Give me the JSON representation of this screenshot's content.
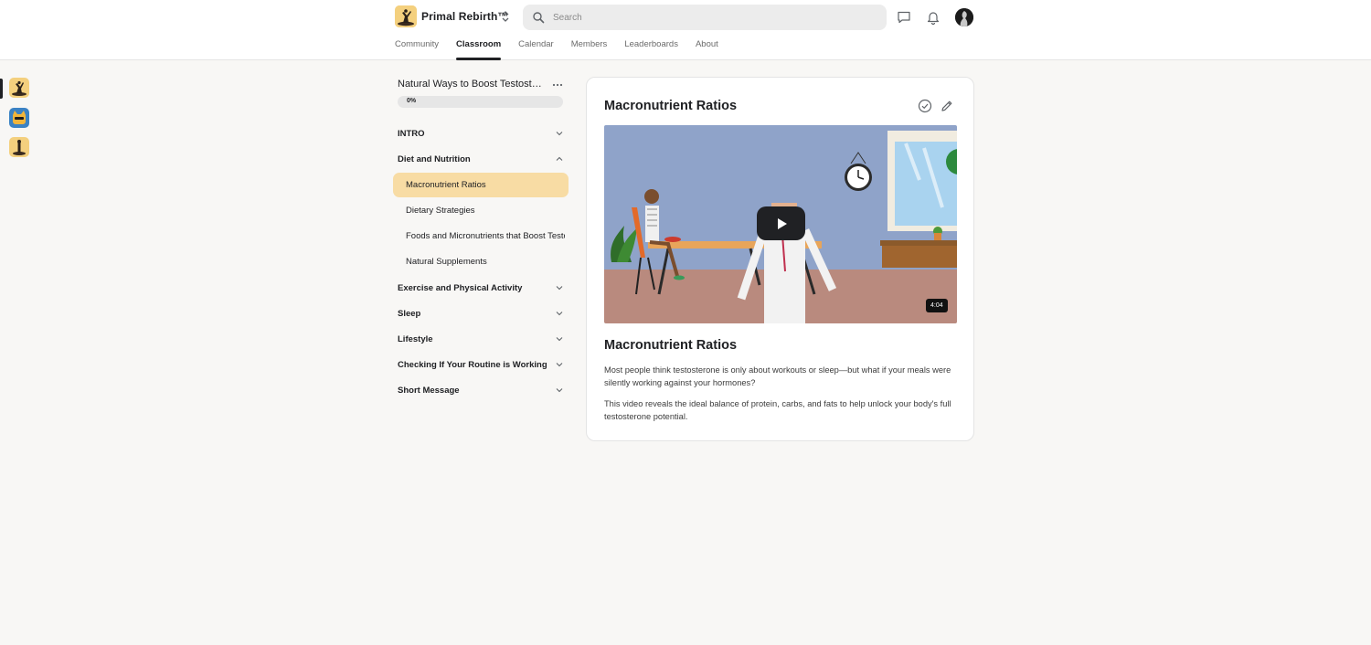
{
  "header": {
    "brand_name": "Primal Rebirth™",
    "search_placeholder": "Search",
    "nav": [
      {
        "label": "Community",
        "active": false
      },
      {
        "label": "Classroom",
        "active": true
      },
      {
        "label": "Calendar",
        "active": false
      },
      {
        "label": "Members",
        "active": false
      },
      {
        "label": "Leaderboards",
        "active": false
      },
      {
        "label": "About",
        "active": false
      }
    ],
    "icons": [
      "chat-icon",
      "bell-icon",
      "avatar"
    ]
  },
  "rail": {
    "apps": [
      {
        "name": "primal-rebirth-app",
        "color": "#f4d07e"
      },
      {
        "name": "cat-app",
        "color": "#3b82c4"
      },
      {
        "name": "statue-app",
        "color": "#f4d07e"
      }
    ]
  },
  "course": {
    "title": "Natural Ways to Boost Testosterone",
    "progress_label": "0%",
    "progress_value": 0,
    "sections": [
      {
        "label": "INTRO",
        "expanded": false
      },
      {
        "label": "Diet and Nutrition",
        "expanded": true
      },
      {
        "label": "Exercise and Physical Activity",
        "expanded": false
      },
      {
        "label": "Sleep",
        "expanded": false
      },
      {
        "label": "Lifestyle",
        "expanded": false
      },
      {
        "label": "Checking If Your Routine is Working",
        "expanded": false
      },
      {
        "label": "Short Message",
        "expanded": false
      }
    ],
    "lessons": [
      {
        "label": "Macronutrient Ratios",
        "active": true
      },
      {
        "label": "Dietary Strategies",
        "active": false
      },
      {
        "label": "Foods and Micronutrients that Boost Testosterone",
        "active": false
      },
      {
        "label": "Natural Supplements",
        "active": false
      }
    ]
  },
  "lesson": {
    "title": "Macronutrient Ratios",
    "video_duration": "4:04",
    "description_title": "Macronutrient Ratios",
    "paragraph_1": "Most people think testosterone is only about workouts or sleep—but what if your meals were silently working against your hormones?",
    "paragraph_2": "This video reveals the ideal balance of protein, carbs, and fats to help unlock your body's full testosterone potential."
  },
  "colors": {
    "active_lesson": "#f8dca4",
    "page_bg": "#f8f7f5",
    "video_wall": "#8fa3c9",
    "video_floor": "#b98a7e"
  }
}
